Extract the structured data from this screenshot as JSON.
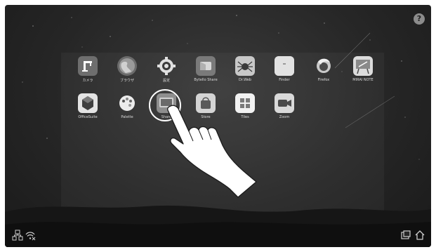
{
  "help": {
    "label": "?"
  },
  "apps": [
    {
      "id": "camera",
      "label": "カメラ",
      "icon": "camera-icon"
    },
    {
      "id": "browser",
      "label": "ブラウザ",
      "icon": "globe-icon"
    },
    {
      "id": "settings",
      "label": "設定",
      "icon": "gear-icon"
    },
    {
      "id": "bytello-share",
      "label": "Bytello Share",
      "icon": "bytello-share-icon"
    },
    {
      "id": "drweb",
      "label": "Dr.Web",
      "icon": "spider-icon"
    },
    {
      "id": "finder",
      "label": "Finder",
      "icon": "folder-icon"
    },
    {
      "id": "firefox",
      "label": "Firefox",
      "icon": "firefox-icon"
    },
    {
      "id": "mirai-note",
      "label": "MIRAI NOTE",
      "icon": "easel-icon"
    },
    {
      "id": "officesuite",
      "label": "OfficeSuite",
      "icon": "officesuite-icon"
    },
    {
      "id": "palette",
      "label": "Palette",
      "icon": "palette-icon"
    },
    {
      "id": "share",
      "label": "Share",
      "icon": "share-screen-icon"
    },
    {
      "id": "store",
      "label": "Store",
      "icon": "bag-icon"
    },
    {
      "id": "tiles",
      "label": "Tiles",
      "icon": "grid-icon"
    },
    {
      "id": "zoom",
      "label": "Zoom",
      "icon": "video-camera-icon"
    }
  ],
  "system_bar": {
    "left": [
      "network-icon",
      "wifi-disconnected-icon"
    ],
    "right": [
      "multitask-icon",
      "home-icon"
    ]
  },
  "colors": {
    "background": "#262626",
    "tile_gray": "#d9d9d9",
    "tile_dark": "#6b6b6b",
    "text": "#dcdcdc"
  }
}
